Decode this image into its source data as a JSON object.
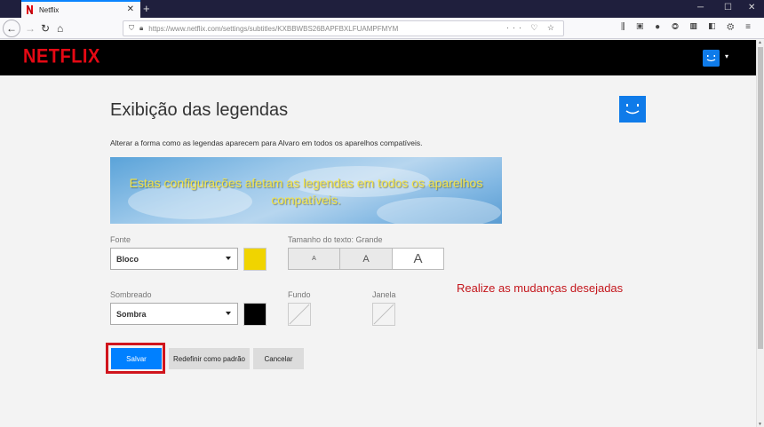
{
  "browser": {
    "tab_title": "Netflix",
    "new_tab": "+",
    "url": "https://www.netflix.com/settings/subtitles/KXBBWBS26BAPFBXLFUAMPFMYM",
    "url_actions": "··· ♡ ☆",
    "window_controls": {
      "minimize": "─",
      "maximize": "☐",
      "close": "✕"
    }
  },
  "header": {
    "logo": "NETFLIX",
    "profile_caret": "▾"
  },
  "main": {
    "title": "Exibição das legendas",
    "description": "Alterar a forma como as legendas aparecem para Alvaro em todos os aparelhos compatíveis.",
    "preview_text": "Estas configurações afetam as legendas em todos os aparelhos compatíveis.",
    "font": {
      "label": "Fonte",
      "value": "Bloco",
      "color": "#f0d400"
    },
    "text_size": {
      "label": "Tamanho do texto: Grande",
      "options": [
        "A",
        "A",
        "A"
      ],
      "selected": "Grande"
    },
    "shadow": {
      "label": "Sombreado",
      "value": "Sombra",
      "color": "#000000"
    },
    "background": {
      "label": "Fundo"
    },
    "window": {
      "label": "Janela"
    },
    "hint": "Realize as mudanças desejadas",
    "buttons": {
      "save": "Salvar",
      "reset": "Redefinir como padrão",
      "cancel": "Cancelar"
    }
  },
  "colors": {
    "netflix_red": "#e50914",
    "primary_blue": "#0080ff",
    "avatar_blue": "#0f7be9",
    "highlight_red": "#d0141c"
  }
}
